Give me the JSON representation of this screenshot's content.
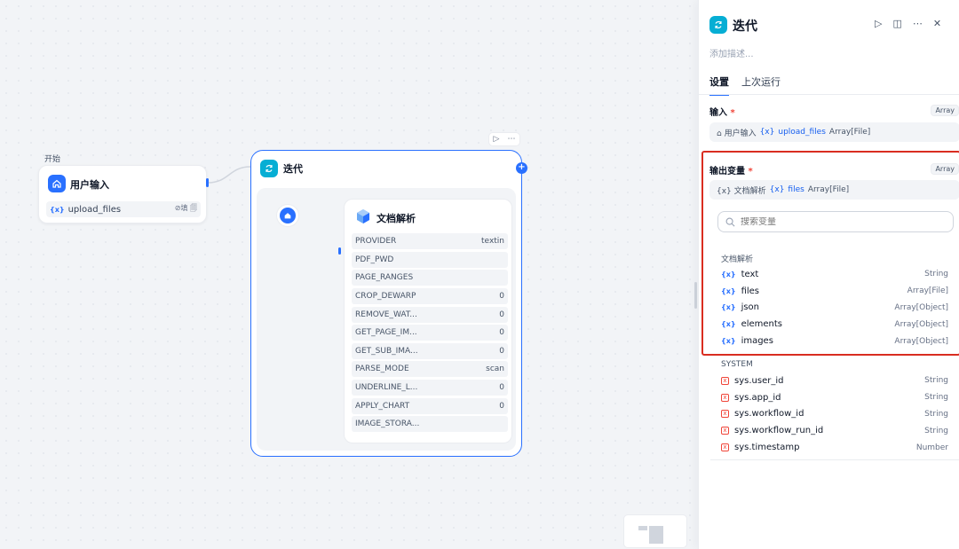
{
  "canvas": {
    "start": {
      "label": "开始",
      "title": "用户输入",
      "var_name": "upload_files",
      "var_right": "⊘填 🗐"
    },
    "iteration": {
      "title": "迭代",
      "actions": [
        "▷",
        "⋯"
      ],
      "plus": "+"
    },
    "doc_parse": {
      "title": "文档解析",
      "params": [
        {
          "name": "PROVIDER",
          "value": "textin"
        },
        {
          "name": "PDF_PWD",
          "value": ""
        },
        {
          "name": "PAGE_RANGES",
          "value": ""
        },
        {
          "name": "CROP_DEWARP",
          "value": "0"
        },
        {
          "name": "REMOVE_WAT...",
          "value": "0"
        },
        {
          "name": "GET_PAGE_IM...",
          "value": "0"
        },
        {
          "name": "GET_SUB_IMA...",
          "value": "0"
        },
        {
          "name": "PARSE_MODE",
          "value": "scan"
        },
        {
          "name": "UNDERLINE_L...",
          "value": "0"
        },
        {
          "name": "APPLY_CHART",
          "value": "0"
        },
        {
          "name": "IMAGE_STORA...",
          "value": ""
        }
      ]
    }
  },
  "panel": {
    "title": "迭代",
    "description_placeholder": "添加描述...",
    "tools": [
      "▷",
      "◫",
      "⋯",
      "✕"
    ],
    "tabs": [
      "设置",
      "上次运行"
    ],
    "active_tab": 0,
    "input": {
      "label": "输入",
      "required": "*",
      "type": "Array",
      "source_node": "⌂ 用户输入",
      "var_prefix": "{x}",
      "var_name": "upload_files",
      "var_type": "Array[File]"
    },
    "output": {
      "label": "输出变量",
      "required": "*",
      "type": "Array",
      "source_node": "{x} 文档解析",
      "var_prefix": "{x}",
      "var_name": "files",
      "var_type": "Array[File]"
    },
    "search_placeholder": "搜索变量",
    "node_group": {
      "label": "文档解析",
      "vars": [
        {
          "name": "text",
          "type": "String"
        },
        {
          "name": "files",
          "type": "Array[File]"
        },
        {
          "name": "json",
          "type": "Array[Object]"
        },
        {
          "name": "elements",
          "type": "Array[Object]"
        },
        {
          "name": "images",
          "type": "Array[Object]"
        }
      ]
    },
    "system_group": {
      "label": "SYSTEM",
      "vars": [
        {
          "name": "sys.user_id",
          "type": "String"
        },
        {
          "name": "sys.app_id",
          "type": "String"
        },
        {
          "name": "sys.workflow_id",
          "type": "String"
        },
        {
          "name": "sys.workflow_run_id",
          "type": "String"
        },
        {
          "name": "sys.timestamp",
          "type": "Number"
        }
      ]
    }
  },
  "colors": {
    "accent": "#2970ff",
    "teal": "#06aed4",
    "highlight": "#d92d20",
    "system_icon": "#f04438"
  },
  "icons": {
    "start": "home-icon",
    "iteration": "loop-icon",
    "doc_parse": "cube-icon",
    "search": "search-icon"
  }
}
